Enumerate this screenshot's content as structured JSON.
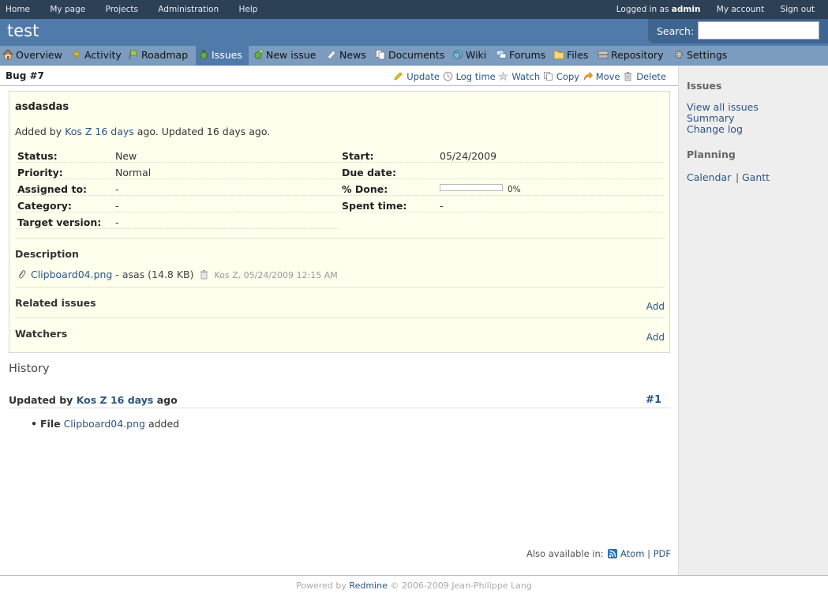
{
  "top_menu": {
    "left_items": [
      "Home",
      "My page",
      "Projects",
      "Administration",
      "Help"
    ],
    "logged_in_prefix": "Logged in as",
    "logged_in_user": "admin",
    "my_account": "My account",
    "sign_out": "Sign out"
  },
  "header": {
    "project_title": "test",
    "search_label": "Search:",
    "search_value": ""
  },
  "main_menu": {
    "tabs": [
      {
        "label": "Overview",
        "icon": "house-icon"
      },
      {
        "label": "Activity",
        "icon": "lightning-icon"
      },
      {
        "label": "Roadmap",
        "icon": "flag-icon"
      },
      {
        "label": "Issues",
        "icon": "bug-icon",
        "selected": true
      },
      {
        "label": "New issue",
        "icon": "new-issue-icon"
      },
      {
        "label": "News",
        "icon": "news-icon"
      },
      {
        "label": "Documents",
        "icon": "documents-icon"
      },
      {
        "label": "Wiki",
        "icon": "wiki-icon"
      },
      {
        "label": "Forums",
        "icon": "forums-icon"
      },
      {
        "label": "Files",
        "icon": "files-icon"
      },
      {
        "label": "Repository",
        "icon": "repository-icon"
      },
      {
        "label": "Settings",
        "icon": "gear-icon"
      }
    ]
  },
  "issue": {
    "heading": "Bug #7",
    "subject": "asdasdas",
    "author_prefix": "Added by",
    "author": "Kos Z",
    "created_ago": "16 days",
    "author_suffix": "ago. Updated 16 days ago.",
    "actions": {
      "update": "Update",
      "log_time": "Log time",
      "watch": "Watch",
      "copy": "Copy",
      "move": "Move",
      "delete": "Delete"
    },
    "attributes_left": [
      {
        "label": "Status:",
        "value": "New"
      },
      {
        "label": "Priority:",
        "value": "Normal"
      },
      {
        "label": "Assigned to:",
        "value": "-"
      },
      {
        "label": "Category:",
        "value": "-"
      },
      {
        "label": "Target version:",
        "value": "-"
      }
    ],
    "attributes_right": [
      {
        "label": "Start:",
        "value": "05/24/2009"
      },
      {
        "label": "Due date:",
        "value": ""
      },
      {
        "label": "% Done:",
        "value": "0%"
      },
      {
        "label": "Spent time:",
        "value": "-"
      }
    ],
    "done_ratio": 0,
    "description_title": "Description",
    "attachment": {
      "filename": "Clipboard04.png",
      "description": "- asas (14.8 KB)",
      "meta": "Kos Z, 05/24/2009 12:15 AM"
    },
    "related_title": "Related issues",
    "related_add": "Add",
    "watchers_title": "Watchers",
    "watchers_add": "Add"
  },
  "history": {
    "title": "History",
    "journal": {
      "prefix": "Updated by",
      "author": "Kos Z",
      "ago": "16 days",
      "suffix": "ago",
      "number": "#1",
      "detail_label": "File",
      "detail_file": "Clipboard04.png",
      "detail_suffix": "added"
    }
  },
  "other_formats": {
    "label": "Also available in:",
    "atom": "Atom",
    "separator": "|",
    "pdf": "PDF"
  },
  "sidebar": {
    "issues_title": "Issues",
    "view_all": "View all issues",
    "summary": "Summary",
    "change_log": "Change log",
    "planning_title": "Planning",
    "calendar": "Calendar",
    "separator": "|",
    "gantt": "Gantt"
  },
  "footer": {
    "powered_by": "Powered by",
    "redmine": "Redmine",
    "copyright": "© 2006-2009 Jean-Philippe Lang"
  },
  "colors": {
    "top_menu_bg": "#2C4056",
    "header_bg": "#507AAA",
    "main_menu_bg": "#7B9CBF",
    "link": "#2A5685",
    "issue_box_bg": "#FFFFEE",
    "sidebar_bg": "#EEEEEE"
  }
}
